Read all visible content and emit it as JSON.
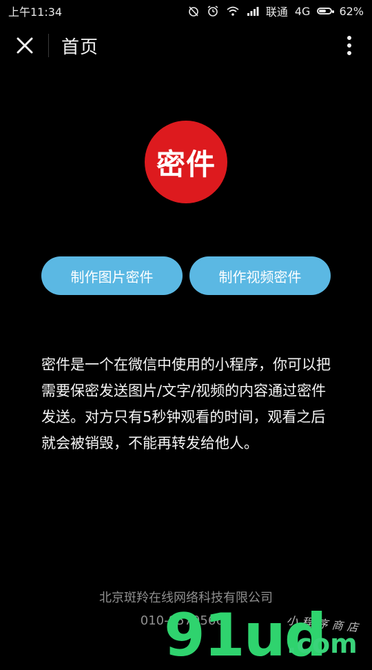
{
  "status_bar": {
    "time": "上午11:34",
    "carrier": "联通",
    "network": "4G",
    "battery": "62%",
    "battery_level": 0.62
  },
  "nav": {
    "title": "首页"
  },
  "logo": {
    "text": "密件",
    "color": "#dd1a1e"
  },
  "buttons": {
    "make_image": "制作图片密件",
    "make_video": "制作视频密件",
    "color": "#5bb8e3"
  },
  "description": "密件是一个在微信中使用的小程序，你可以把需要保密发送图片/文字/视频的内容通过密件发送。对方只有5秒钟观看的时间，观看之后就会被销毁，不能再转发给他人。",
  "footer": {
    "company": "北京斑羚在线网络科技有限公司",
    "phone": "010-85795663"
  },
  "watermark": {
    "main": "91ud",
    "suffix": ".com",
    "caption": "小程序商店"
  },
  "icons": {
    "close": "close-icon",
    "more": "more-vertical-icon"
  }
}
